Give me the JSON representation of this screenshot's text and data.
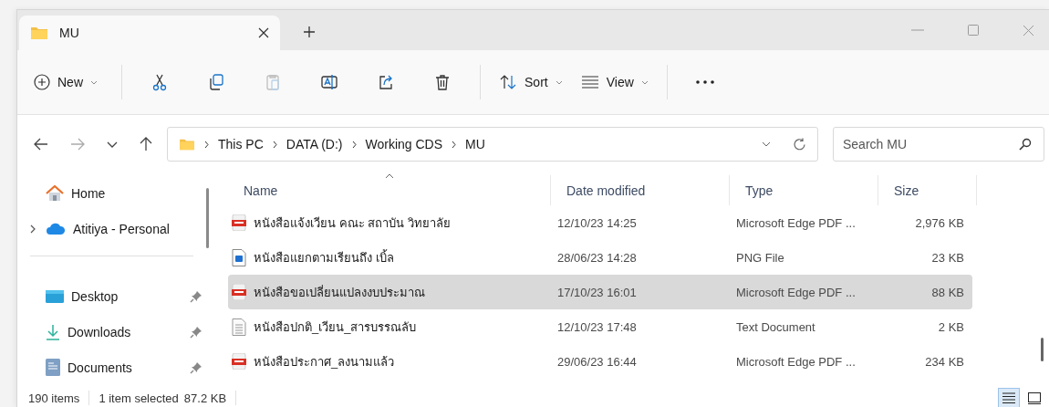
{
  "tabs": [
    {
      "title": "MU",
      "selected": true
    }
  ],
  "toolbar": {
    "new_label": "New",
    "sort_label": "Sort",
    "view_label": "View",
    "tools": [
      {
        "kind": "cut",
        "disabled": false
      },
      {
        "kind": "copy",
        "disabled": false
      },
      {
        "kind": "paste",
        "disabled": true
      },
      {
        "kind": "rename",
        "disabled": false
      },
      {
        "kind": "share",
        "disabled": false
      },
      {
        "kind": "delete",
        "disabled": false
      }
    ]
  },
  "address": {
    "crumbs": [
      "This PC",
      "DATA (D:)",
      "Working CDS",
      "MU"
    ]
  },
  "search": {
    "placeholder": "Search MU"
  },
  "sidebar": {
    "items": [
      {
        "label": "Home",
        "kind": "home",
        "pinned": false
      },
      {
        "label": "Atitiya - Personal",
        "kind": "cloud",
        "pinned": false,
        "expanded": false
      },
      {
        "kind": "divider"
      },
      {
        "label": "Desktop",
        "kind": "desktop",
        "pinned": true
      },
      {
        "label": "Downloads",
        "kind": "downloads",
        "pinned": true
      },
      {
        "label": "Documents",
        "kind": "documents",
        "pinned": true
      }
    ]
  },
  "table": {
    "columns": [
      {
        "label": "Name",
        "sorted": true
      },
      {
        "label": "Date modified",
        "sorted": false
      },
      {
        "label": "Type",
        "sorted": false
      },
      {
        "label": "Size",
        "sorted": false
      }
    ],
    "rows": [
      {
        "name": "หนังสือแจ้งเวียน คณะ สถาบัน วิทยาลัย",
        "kind": "pdf",
        "date": "12/10/23 14:25",
        "type": "Microsoft Edge PDF ...",
        "size": "2,976 KB",
        "selected": false
      },
      {
        "name": "หนังสือแยกตามเรียนถึง เบิ้ล",
        "kind": "png",
        "date": "28/06/23 14:28",
        "type": "PNG File",
        "size": "23 KB",
        "selected": false
      },
      {
        "name": "หนังสือขอเปลี่ยนแปลงงบประมาณ",
        "kind": "pdf",
        "date": "17/10/23 16:01",
        "type": "Microsoft Edge PDF ...",
        "size": "88 KB",
        "selected": true
      },
      {
        "name": "หนังสือปกติ_เวียน_สารบรรณลับ",
        "kind": "txt",
        "date": "12/10/23 17:48",
        "type": "Text Document",
        "size": "2 KB",
        "selected": false
      },
      {
        "name": "หนังสือประกาศ_ลงนามแล้ว",
        "kind": "pdf",
        "date": "29/06/23 16:44",
        "type": "Microsoft Edge PDF ...",
        "size": "234 KB",
        "selected": false
      }
    ]
  },
  "status_bar": {
    "count": "190 items",
    "selection": "1 item selected",
    "size": "87.2 KB"
  },
  "views": [
    {
      "kind": "details",
      "selected": true
    },
    {
      "kind": "tiles",
      "selected": false
    }
  ]
}
